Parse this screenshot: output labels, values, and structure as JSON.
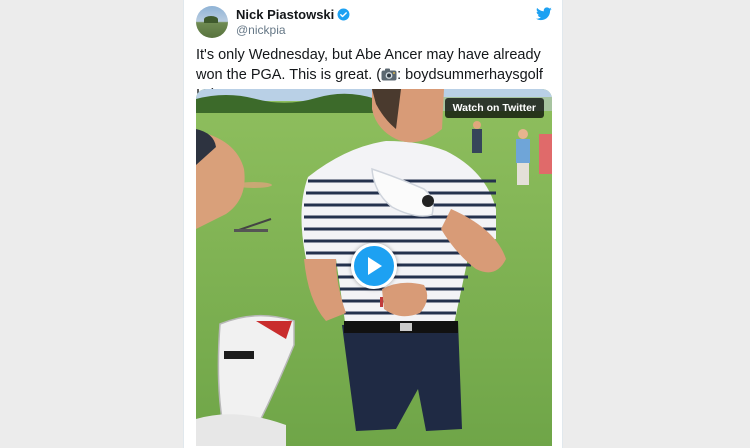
{
  "tweet": {
    "display_name": "Nick Piastowski",
    "handle": "@nickpia",
    "text_before_icon": "It's only Wednesday, but Abe Ancer may have already won the PGA. This is great. (",
    "text_after_icon": ": boydsummerhaysgolf IG)"
  },
  "media": {
    "watch_label": "Watch on Twitter"
  },
  "icons": {
    "bird": "twitter-bird-icon",
    "verified": "verified-badge-icon",
    "camera": "camera-flash-icon",
    "play": "play-icon"
  },
  "colors": {
    "twitter_blue": "#1da1f2",
    "text": "#14171a",
    "secondary": "#657786"
  }
}
